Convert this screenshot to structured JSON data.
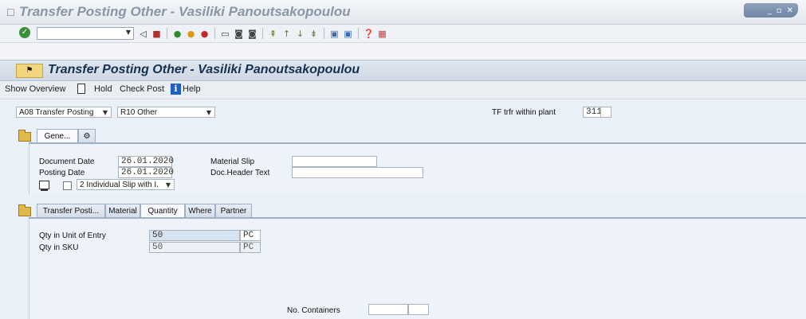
{
  "window": {
    "title": "Transfer Posting Other - Vasiliki Panoutsakopoulou"
  },
  "toolbar": {
    "command_value": ""
  },
  "app": {
    "title": "Transfer Posting Other - Vasiliki Panoutsakopoulou",
    "actions": {
      "show_overview": "Show Overview",
      "hold": "Hold",
      "check": "Check",
      "post": "Post",
      "help": "Help"
    }
  },
  "header": {
    "transaction_select": "A08 Transfer Posting",
    "reference_select": "R10 Other",
    "movement_label": "TF trfr within plant",
    "movement_type": "311",
    "movement_extra": ""
  },
  "general": {
    "tab": "Gene...",
    "document_date_label": "Document Date",
    "document_date": "26.01.2020",
    "posting_date_label": "Posting Date",
    "posting_date": "26.01.2020",
    "material_slip_label": "Material Slip",
    "material_slip": "",
    "doc_header_label": "Doc.Header Text",
    "doc_header": "",
    "print_option": "2 Individual Slip with I."
  },
  "item_tabs": [
    "Transfer Posti...",
    "Material",
    "Quantity",
    "Where",
    "Partner"
  ],
  "quantity": {
    "qty_entry_label": "Qty in Unit of Entry",
    "qty_entry": "50",
    "qty_entry_unit": "PC",
    "qty_sku_label": "Qty in SKU",
    "qty_sku": "50",
    "qty_sku_unit": "PC",
    "containers_label": "No. Containers",
    "containers": "",
    "containers_extra": ""
  },
  "colors": {
    "header_title": "#16304f",
    "accent": "#1f5fc0"
  }
}
